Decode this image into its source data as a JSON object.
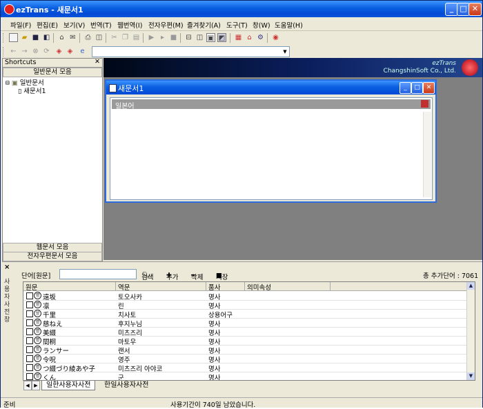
{
  "window": {
    "title": "ezTrans - 새문서1"
  },
  "menu": [
    "파일(F)",
    "편집(E)",
    "보기(V)",
    "번역(T)",
    "웹번역(I)",
    "전자우편(M)",
    "즐겨찾기(A)",
    "도구(T)",
    "창(W)",
    "도움말(H)"
  ],
  "shortcuts": {
    "title": "Shortcuts",
    "group_top": "일반문서 모음",
    "tree_root": "일반문서",
    "tree_child": "새문서1",
    "group_web": "웹문서 모음",
    "group_mail": "전자우편문서 모음"
  },
  "banner": {
    "line1": "ezTrans",
    "line2": "ChangshinSoft Co., Ltd."
  },
  "child_window": {
    "title": "새문서1",
    "pane_label": "일본어"
  },
  "dictionary": {
    "word_label": "단어[원문]",
    "word_value": "",
    "search": "검색",
    "add": "추가",
    "delete": "삭제",
    "save": "저장",
    "total": "총 추가단어 : 7061",
    "vertical_label": "사용자 사전 창",
    "columns": [
      "원문",
      "역문",
      "품사",
      "의미속성"
    ],
    "rows": [
      {
        "badge": "명",
        "src": "遠坂",
        "dst": "토오사카",
        "pos": "명사",
        "sem": ""
      },
      {
        "badge": "명",
        "src": "凛",
        "dst": "린",
        "pos": "명사",
        "sem": ""
      },
      {
        "badge": "상",
        "src": "千里",
        "dst": "치사토",
        "pos": "상용어구",
        "sem": ""
      },
      {
        "badge": "명",
        "src": "慈ねえ",
        "dst": "후지누님",
        "pos": "명사",
        "sem": ""
      },
      {
        "badge": "명",
        "src": "美綴",
        "dst": "미츠즈리",
        "pos": "명사",
        "sem": ""
      },
      {
        "badge": "명",
        "src": "間桐",
        "dst": "마토우",
        "pos": "명사",
        "sem": ""
      },
      {
        "badge": "명",
        "src": "ランサー",
        "dst": "랜서",
        "pos": "명사",
        "sem": ""
      },
      {
        "badge": "명",
        "src": "令呪",
        "dst": "영주",
        "pos": "명사",
        "sem": ""
      },
      {
        "badge": "명",
        "src": "つ綴づり綾あや子",
        "dst": "미츠즈리 아야코",
        "pos": "명사",
        "sem": ""
      },
      {
        "badge": "명",
        "src": "くん",
        "dst": "군",
        "pos": "명사",
        "sem": ""
      }
    ],
    "tabs": [
      "일한사용자사전",
      "한일사용자사전"
    ]
  },
  "status": {
    "left": "준비",
    "center": "사용기간이 740일 남았습니다."
  }
}
